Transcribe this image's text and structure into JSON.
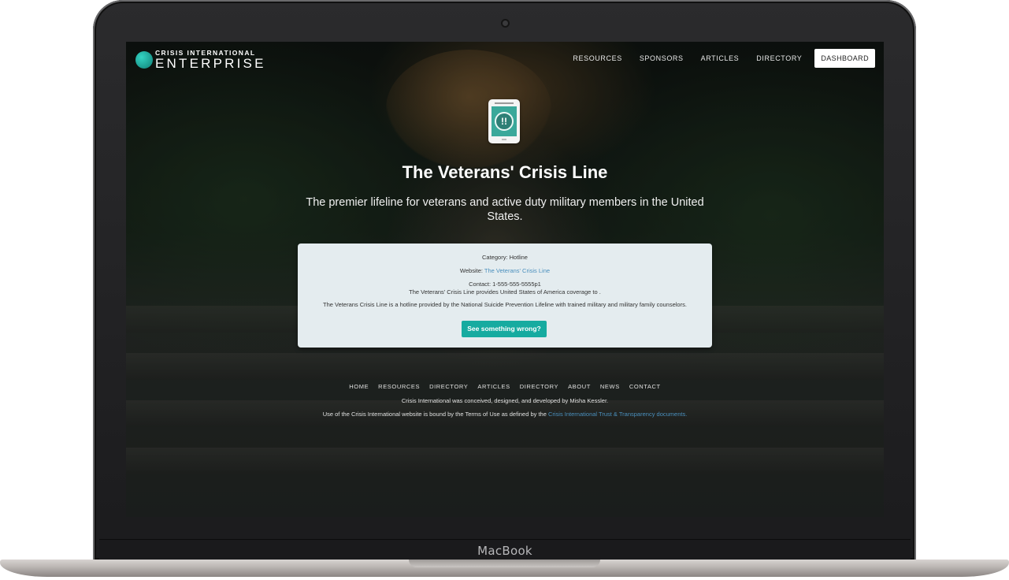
{
  "device": {
    "brand_label": "MacBook"
  },
  "site": {
    "logo": {
      "line1": "CRISIS INTERNATIONAL",
      "line2": "ENTERPRISE"
    },
    "nav": {
      "links": [
        "RESOURCES",
        "SPONSORS",
        "ARTICLES",
        "DIRECTORY"
      ],
      "dashboard": "DASHBOARD"
    },
    "hero": {
      "title": "The Veterans' Crisis Line",
      "subtitle": "The premier lifeline for veterans and active duty military members in the United States."
    },
    "card": {
      "category": "Category: Hotline",
      "website_label": "Website: ",
      "website_link": "The Veterans' Crisis Line",
      "contact": "Contact: 1-555-555-5555p1",
      "coverage": "The Veterans' Crisis Line provides United States of America coverage to .",
      "description": "The Veterans Crisis Line is a hotline provided by the National Suicide Prevention Lifeline with trained military and military family counselors.",
      "button": "See something wrong?"
    },
    "footer": {
      "links": [
        "HOME",
        "RESOURCES",
        "DIRECTORY",
        "ARTICLES",
        "DIRECTORY",
        "ABOUT",
        "NEWS",
        "CONTACT"
      ],
      "credit": "Crisis International was conceived, designed, and developed by Misha Kessler.",
      "terms_prefix": "Use of the Crisis International website is bound by the Terms of Use as defined by the ",
      "terms_link": "Crisis International Trust & Transparency documents."
    }
  },
  "colors": {
    "accent": "#16aba0",
    "link": "#4a8fbd",
    "card_bg": "#e4ecef"
  },
  "icons": {
    "logo": "globe-icon",
    "hero": "phone-alert-icon",
    "camera": "camera-icon"
  }
}
